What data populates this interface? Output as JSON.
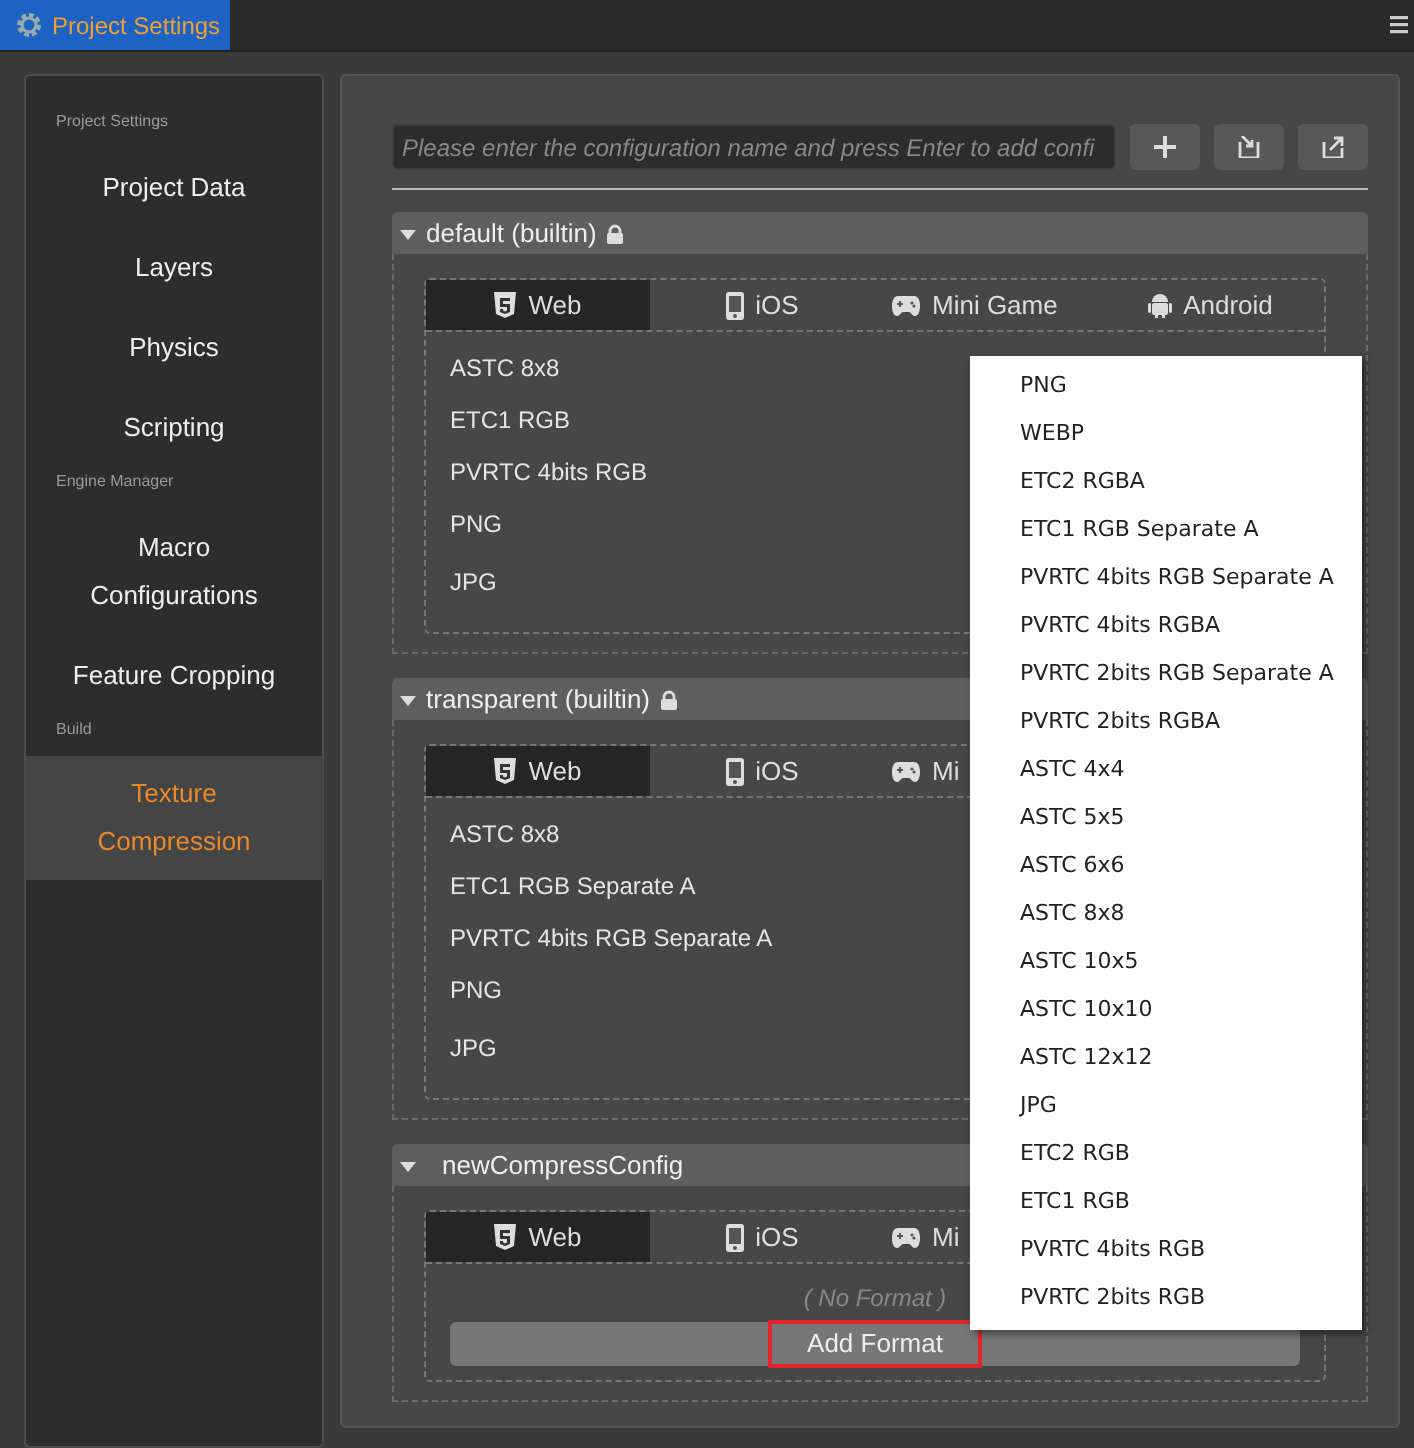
{
  "window": {
    "title": "Project Settings"
  },
  "sidebar": {
    "groups": [
      {
        "label": "Project Settings",
        "items": [
          {
            "label": "Project Data",
            "selected": false
          },
          {
            "label": "Layers",
            "selected": false
          },
          {
            "label": "Physics",
            "selected": false
          },
          {
            "label": "Scripting",
            "selected": false
          }
        ]
      },
      {
        "label": "Engine Manager",
        "items": [
          {
            "label": "Macro\nConfigurations",
            "selected": false
          },
          {
            "label": "Feature Cropping",
            "selected": false
          }
        ]
      },
      {
        "label": "Build",
        "items": [
          {
            "label": "Texture\nCompression",
            "selected": true
          }
        ]
      }
    ]
  },
  "search": {
    "placeholder": "Please enter the configuration name and press Enter to add confi"
  },
  "configs": [
    {
      "name": "default (builtin)",
      "locked": true,
      "expanded": true,
      "tabs": [
        {
          "label": "Web",
          "kind": "web",
          "selected": true
        },
        {
          "label": "iOS",
          "kind": "ios",
          "selected": false
        },
        {
          "label": "Mini Game",
          "kind": "minigame",
          "selected": false
        },
        {
          "label": "Android",
          "kind": "android",
          "selected": false
        }
      ],
      "formats": [
        "ASTC 8x8",
        "ETC1 RGB",
        "PVRTC 4bits RGB",
        "PNG",
        "JPG"
      ]
    },
    {
      "name": "transparent (builtin)",
      "locked": true,
      "expanded": true,
      "tabs": [
        {
          "label": "Web",
          "kind": "web",
          "selected": true
        },
        {
          "label": "iOS",
          "kind": "ios",
          "selected": false
        },
        {
          "label": "Mi",
          "kind": "minigame",
          "selected": false
        }
      ],
      "formats": [
        "ASTC 8x8",
        "ETC1 RGB Separate A",
        "PVRTC 4bits RGB Separate A",
        "PNG",
        "JPG"
      ]
    },
    {
      "name": "newCompressConfig",
      "locked": false,
      "expanded": true,
      "tabs": [
        {
          "label": "Web",
          "kind": "web",
          "selected": true
        },
        {
          "label": "iOS",
          "kind": "ios",
          "selected": false
        },
        {
          "label": "Mi",
          "kind": "minigame",
          "selected": false
        }
      ],
      "empty_text": "( No Format )",
      "add_button": {
        "label": "Add Format",
        "highlighted": true
      }
    }
  ],
  "menu": {
    "items": [
      "PNG",
      "WEBP",
      "ETC2 RGBA",
      "ETC1 RGB Separate A",
      "PVRTC 4bits RGB Separate A",
      "PVRTC 4bits RGBA",
      "PVRTC 2bits RGB Separate A",
      "PVRTC 2bits RGBA",
      "ASTC 4x4",
      "ASTC 5x5",
      "ASTC 6x6",
      "ASTC 8x8",
      "ASTC 10x5",
      "ASTC 10x10",
      "ASTC 12x12",
      "JPG",
      "ETC2 RGB",
      "ETC1 RGB",
      "PVRTC 4bits RGB",
      "PVRTC 2bits RGB"
    ]
  }
}
